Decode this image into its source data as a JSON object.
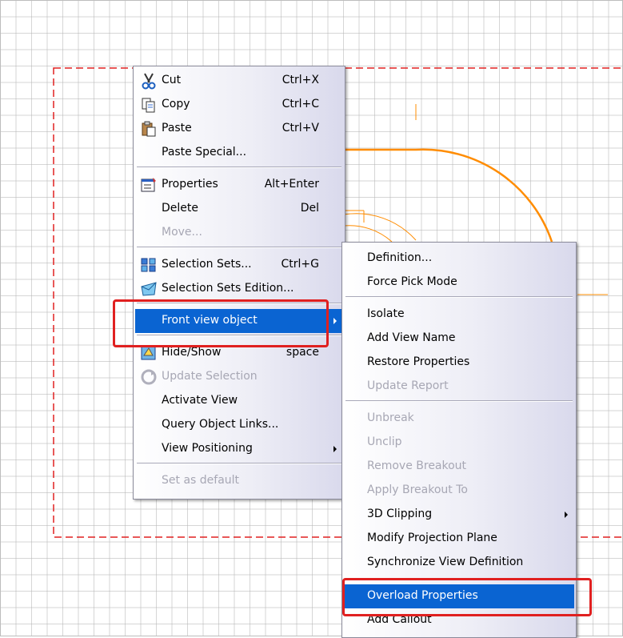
{
  "context_menu": {
    "items": [
      {
        "label": "Cut",
        "shortcut": "Ctrl+X",
        "icon": "scissors-icon"
      },
      {
        "label": "Copy",
        "shortcut": "Ctrl+C",
        "icon": "copy-icon"
      },
      {
        "label": "Paste",
        "shortcut": "Ctrl+V",
        "icon": "paste-icon"
      },
      {
        "label": "Paste Special...",
        "shortcut": ""
      },
      {
        "label": "Properties",
        "shortcut": "Alt+Enter",
        "icon": "properties-icon"
      },
      {
        "label": "Delete",
        "shortcut": "Del"
      },
      {
        "label": "Move...",
        "shortcut": "",
        "disabled": true
      },
      {
        "label": "Selection Sets...",
        "shortcut": "Ctrl+G",
        "icon": "selection-sets-icon"
      },
      {
        "label": "Selection Sets Edition...",
        "shortcut": "",
        "icon": "selection-sets-edition-icon"
      },
      {
        "label": "Front view object",
        "shortcut": "",
        "submenu": true,
        "highlighted": true
      },
      {
        "label": "Hide/Show",
        "shortcut": "space",
        "icon": "hide-show-icon"
      },
      {
        "label": "Update Selection",
        "shortcut": "",
        "disabled": true,
        "icon": "update-icon"
      },
      {
        "label": "Activate View",
        "shortcut": ""
      },
      {
        "label": "Query Object Links...",
        "shortcut": ""
      },
      {
        "label": "View Positioning",
        "shortcut": "",
        "submenu": true
      },
      {
        "label": "Set as default",
        "shortcut": "",
        "disabled": true
      }
    ]
  },
  "submenu": {
    "items": [
      {
        "label": "Definition..."
      },
      {
        "label": "Force Pick Mode"
      },
      {
        "label": "Isolate"
      },
      {
        "label": "Add View Name"
      },
      {
        "label": "Restore Properties"
      },
      {
        "label": "Update Report",
        "disabled": true
      },
      {
        "label": "Unbreak",
        "disabled": true
      },
      {
        "label": "Unclip",
        "disabled": true
      },
      {
        "label": "Remove Breakout",
        "disabled": true
      },
      {
        "label": "Apply Breakout To",
        "disabled": true
      },
      {
        "label": "3D Clipping",
        "submenu": true
      },
      {
        "label": "Modify Projection Plane"
      },
      {
        "label": "Synchronize View Definition"
      },
      {
        "label": "Overload Properties",
        "highlighted": true
      },
      {
        "label": "Add Callout"
      }
    ]
  },
  "colors": {
    "highlight": "#0a64d2",
    "annotation": "#e02020",
    "geometry": "#ff8c00",
    "view_frame": "#e02020"
  }
}
